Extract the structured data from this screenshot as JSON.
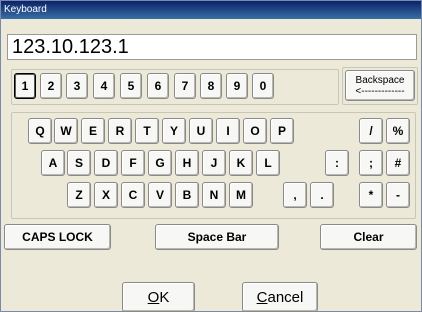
{
  "window": {
    "title": "Keyboard"
  },
  "display": {
    "value": "123.10.123.1"
  },
  "number_row": [
    "1",
    "2",
    "3",
    "4",
    "5",
    "6",
    "7",
    "8",
    "9",
    "0"
  ],
  "backspace": {
    "label": "Backspace",
    "arrow": "<-------------"
  },
  "row1": [
    "Q",
    "W",
    "E",
    "R",
    "T",
    "Y",
    "U",
    "I",
    "O",
    "P",
    "/",
    "%"
  ],
  "row2": [
    "A",
    "S",
    "D",
    "F",
    "G",
    "H",
    "J",
    "K",
    "L",
    ":",
    ";",
    "#"
  ],
  "row3": [
    "Z",
    "X",
    "C",
    "V",
    "B",
    "N",
    "M",
    ",",
    ".",
    "*",
    "-"
  ],
  "controls": {
    "caps": "CAPS LOCK",
    "space": "Space Bar",
    "clear": "Clear"
  },
  "actions": {
    "ok_u": "O",
    "ok_rest": "K",
    "cancel_u": "C",
    "cancel_rest": "ancel"
  }
}
